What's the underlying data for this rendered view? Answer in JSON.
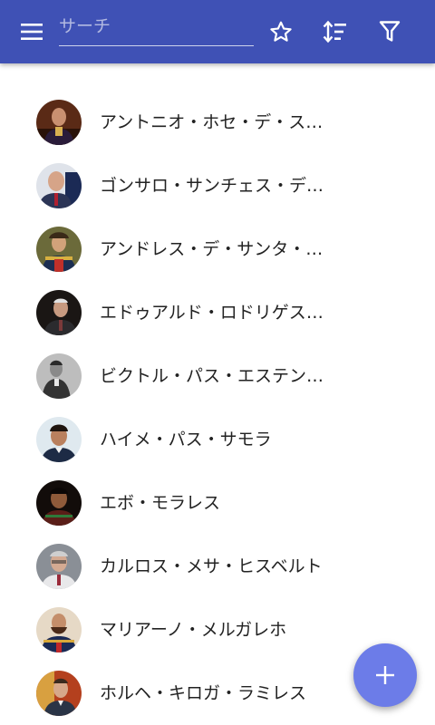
{
  "appbar": {
    "menu_icon": "menu-icon",
    "search": {
      "placeholder": "サーチ",
      "value": ""
    },
    "star_icon": "star-outline-icon",
    "sort_icon": "sort-icon",
    "filter_icon": "filter-icon",
    "background": "#3f51b5"
  },
  "list": {
    "items": [
      {
        "name": "アントニオ・ホセ・デ・スクレ"
      },
      {
        "name": "ゴンサロ・サンチェス・デ・ロサダ"
      },
      {
        "name": "アンドレス・デ・サンタ・クルス"
      },
      {
        "name": "エドゥアルド・ロドリゲス・ベルツェ"
      },
      {
        "name": "ビクトル・パス・エステンソロ"
      },
      {
        "name": "ハイメ・パス・サモラ"
      },
      {
        "name": "エボ・モラレス"
      },
      {
        "name": "カルロス・メサ・ヒスベルト"
      },
      {
        "name": "マリアーノ・メルガレホ"
      },
      {
        "name": "ホルヘ・キロガ・ラミレス"
      }
    ]
  },
  "fab": {
    "icon": "plus-icon",
    "color": "#6c7ce8"
  }
}
